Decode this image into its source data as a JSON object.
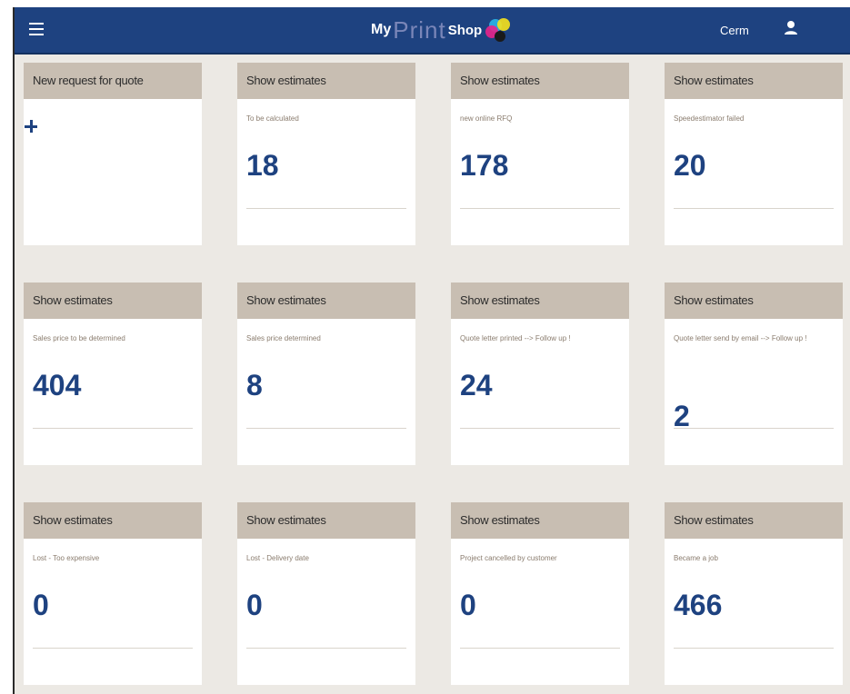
{
  "header": {
    "logo": {
      "my": "My",
      "print": "Print",
      "shop": "Shop"
    },
    "username": "Cerm",
    "menu_icon": "hamburger-menu-icon",
    "user_icon": "user-icon",
    "colors": {
      "bar": "#1e4280",
      "accent": "#1e4280",
      "tile_header": "#c8beb2"
    }
  },
  "new_request": {
    "title": "New request for quote",
    "icon": "plus-icon"
  },
  "tiles": [
    {
      "title": "Show estimates",
      "label": "To be calculated",
      "count": "18"
    },
    {
      "title": "Show estimates",
      "label": "new online RFQ",
      "count": "178"
    },
    {
      "title": "Show estimates",
      "label": "Speedestimator failed",
      "count": "20"
    },
    {
      "title": "Show estimates",
      "label": "Sales price to be determined",
      "count": "404"
    },
    {
      "title": "Show estimates",
      "label": "Sales price determined",
      "count": "8"
    },
    {
      "title": "Show estimates",
      "label": "Quote letter printed --> Follow up !",
      "count": "24"
    },
    {
      "title": "Show estimates",
      "label": "Quote letter send by email --> Follow up !",
      "count": "2"
    },
    {
      "title": "Show estimates",
      "label": "Lost - Too expensive",
      "count": "0"
    },
    {
      "title": "Show estimates",
      "label": "Lost - Delivery date",
      "count": "0"
    },
    {
      "title": "Show estimates",
      "label": "Project cancelled by customer",
      "count": "0"
    },
    {
      "title": "Show estimates",
      "label": "Became a job",
      "count": "466"
    }
  ]
}
